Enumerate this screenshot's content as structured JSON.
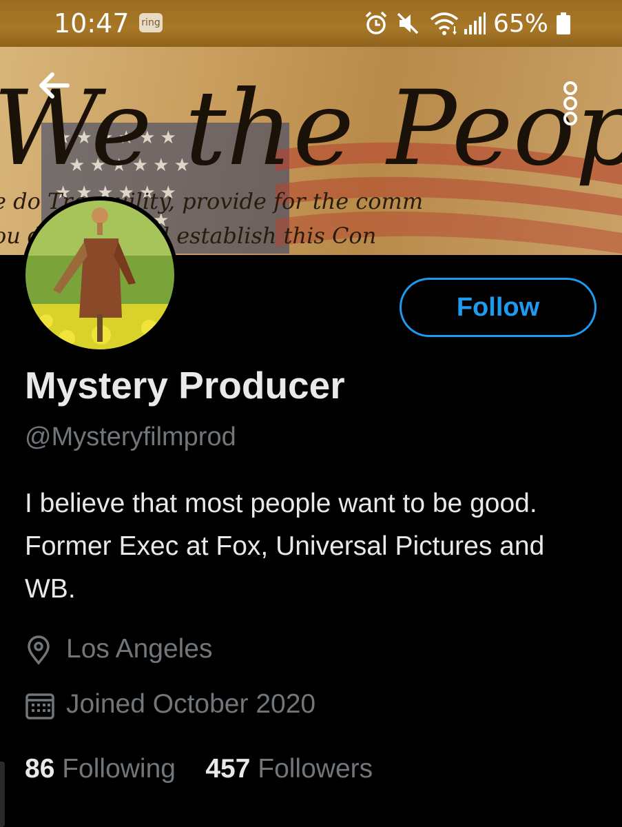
{
  "status_bar": {
    "time": "10:47",
    "ring_badge": "ring",
    "battery_percent": "65%",
    "icons": [
      "alarm-icon",
      "mute-icon",
      "wifi-icon",
      "signal-icon",
      "battery-icon"
    ]
  },
  "banner": {
    "text_large": "We the People",
    "text_small_1": "e do Tranquility, provide for the comm",
    "text_small_2": "ou d ordain and establish this Con"
  },
  "profile": {
    "display_name": "Mystery Producer",
    "handle": "@Mysteryfilmprod",
    "bio": "I believe that most people want to be good. Former Exec at Fox, Universal Pictures and WB.",
    "location": "Los Angeles",
    "joined": "Joined October 2020",
    "following_count": "86",
    "following_label": "Following",
    "followers_count": "457",
    "followers_label": "Followers",
    "follow_button": "Follow"
  },
  "colors": {
    "accent": "#1d9bf0",
    "status_bar": "#a87828",
    "background": "#000000",
    "muted_text": "#71767b"
  }
}
